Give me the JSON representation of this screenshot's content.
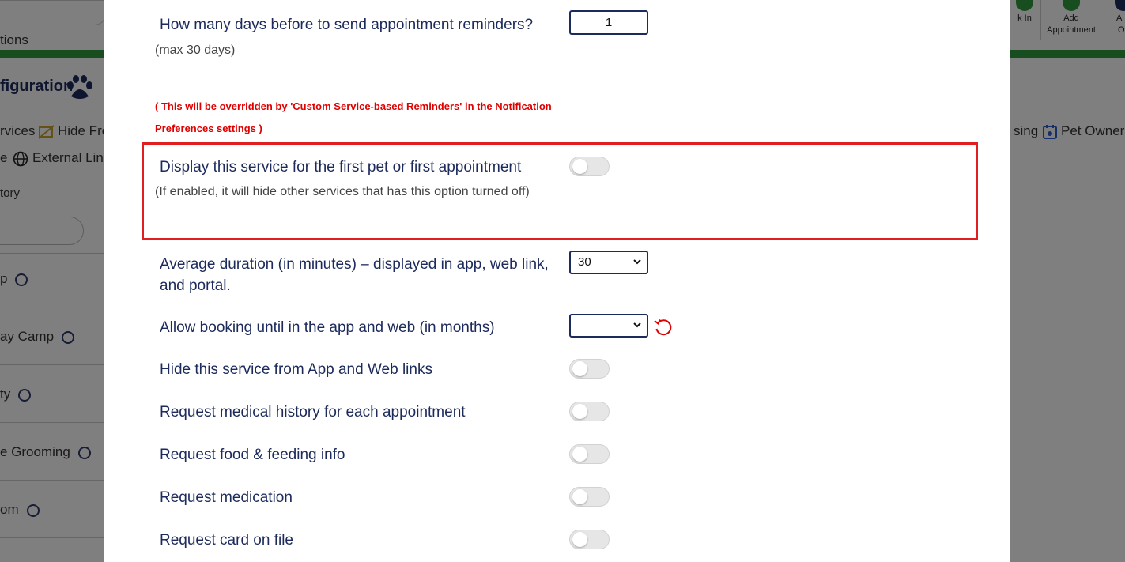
{
  "background": {
    "left_items": {
      "options_partial": "tions",
      "config_title_partial": "figuration",
      "services_partial": "rvices",
      "hide_from_partial": "Hide Fro",
      "e_partial": "e",
      "external_link_partial": "External Link",
      "category_partial": "tory",
      "row1": "p",
      "row2": "ay Camp",
      "row3": "ty",
      "row4": "e Grooming",
      "row5": "om"
    },
    "right_items": {
      "check_in_partial": "k In",
      "add_appointment": "Add Appointment",
      "add_partial_1": "A",
      "add_partial_2": "O",
      "sing_partial": "sing",
      "pet_owner_partial": "Pet Owner"
    }
  },
  "modal": {
    "reminders": {
      "label": "How many days before to send appointment reminders?",
      "hint": "(max 30 days)",
      "value": "1",
      "warning": "( This will be overridden by 'Custom Service-based Reminders' in the Notification Preferences settings )"
    },
    "first_pet": {
      "label": "Display this service for the first pet or first appointment",
      "hint": "(If enabled, it will hide other services that has this option turned off)",
      "enabled": false
    },
    "duration": {
      "label": "Average duration (in minutes) – displayed in app, web link, and portal.",
      "value": "30"
    },
    "booking_until": {
      "label": "Allow booking until in the app and web (in months)",
      "value": ""
    },
    "toggles": [
      {
        "label": "Hide this service from App and Web links",
        "enabled": false
      },
      {
        "label": "Request medical history for each appointment",
        "enabled": false
      },
      {
        "label": "Request food & feeding info",
        "enabled": false
      },
      {
        "label": "Request medication",
        "enabled": false
      },
      {
        "label": "Request card on file",
        "enabled": false
      }
    ]
  },
  "colors": {
    "accent_green": "#2e9b3e",
    "navy": "#1c2a5c",
    "warning_red": "#e00000",
    "highlight_red": "#e02020"
  }
}
